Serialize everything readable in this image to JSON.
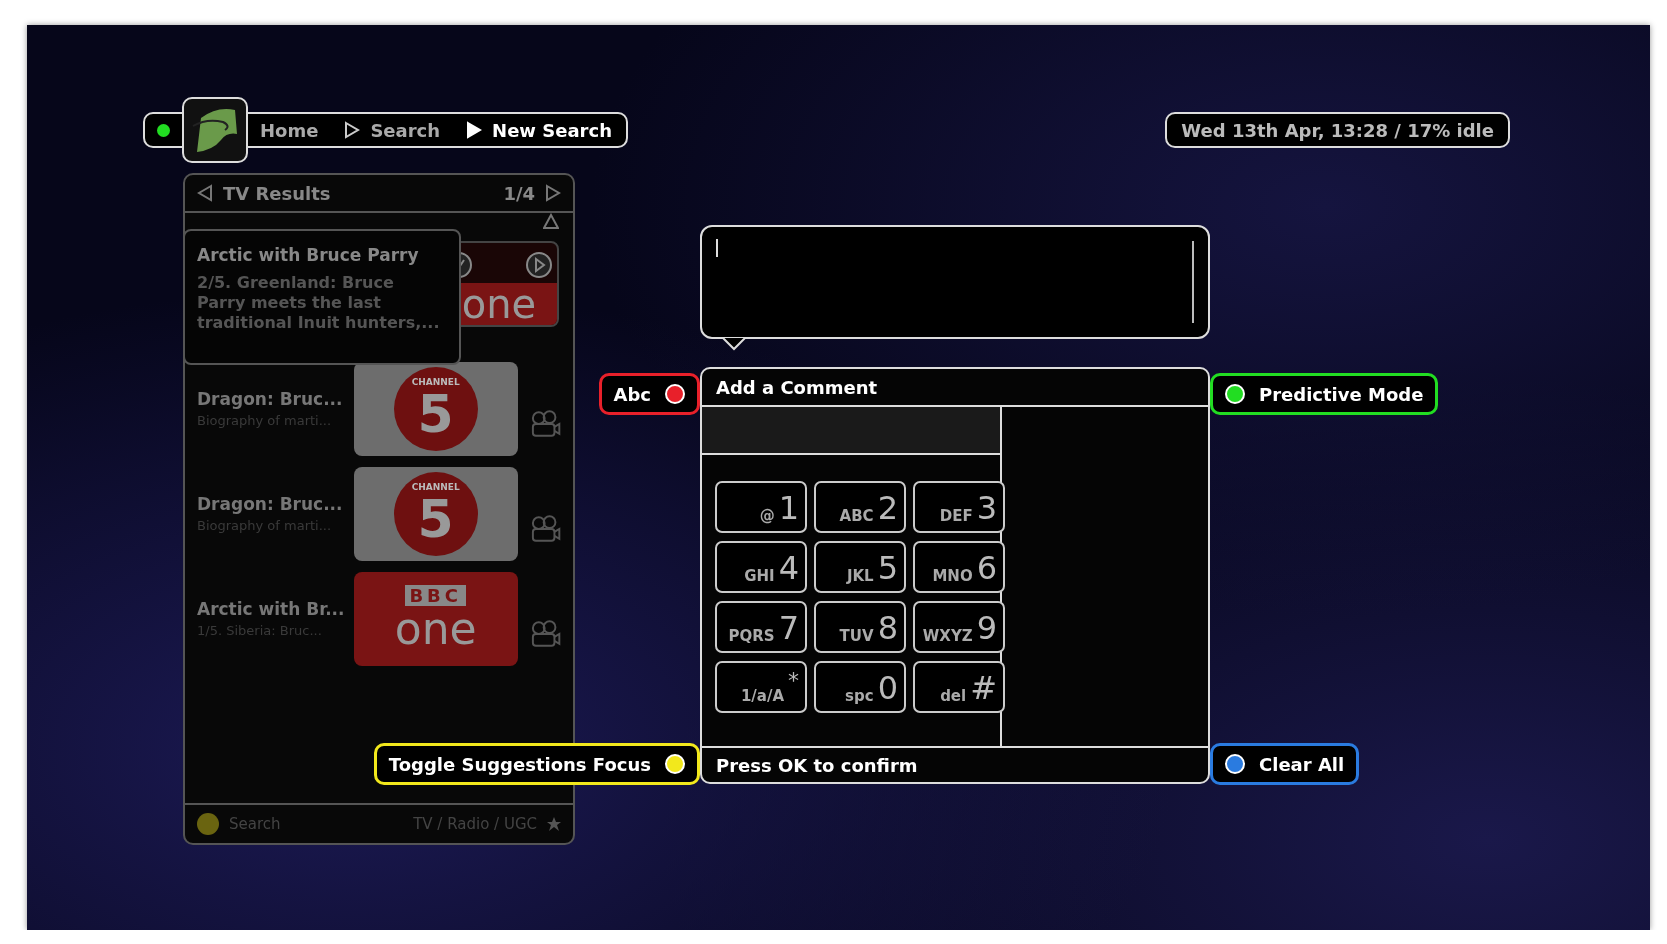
{
  "breadcrumb": {
    "items": [
      {
        "label": "Home",
        "selected": false
      },
      {
        "label": "Search",
        "selected": false
      },
      {
        "label": "New Search",
        "selected": true
      }
    ]
  },
  "status": "Wed 13th Apr, 13:28 / 17% idle",
  "results": {
    "title": "TV Results",
    "page": "1/4",
    "highlight": {
      "title": "Arctic with Bruce Parry",
      "description": "2/5. Greenland: Bruce Parry meets the last traditional Inuit hunters,...",
      "logo": {
        "kind": "bbc",
        "main": "one"
      }
    },
    "items": [
      {
        "title": "Dragon: Bruc...",
        "subtitle": "Biography of marti...",
        "logo": {
          "kind": "channel5",
          "top": "CHANNEL",
          "main": "5"
        }
      },
      {
        "title": "Dragon: Bruc...",
        "subtitle": "Biography of marti...",
        "logo": {
          "kind": "channel5",
          "top": "CHANNEL",
          "main": "5"
        }
      },
      {
        "title": "Arctic with Br...",
        "subtitle": "1/5. Siberia: Bruc...",
        "logo": {
          "kind": "bbc",
          "top": "BBC",
          "main": "one"
        }
      }
    ],
    "footer": {
      "label": "Search",
      "scope": "TV / Radio / UGC"
    }
  },
  "color_buttons": [
    {
      "label": "Abc",
      "color": "#e8202a"
    },
    {
      "label": "Predictive Mode",
      "color": "#22dd22"
    },
    {
      "label": "Toggle Suggestions Focus",
      "color": "#f2e81c"
    },
    {
      "label": "Clear All",
      "color": "#2a7be0"
    }
  ],
  "comment": {
    "title": "Add a Comment",
    "footer": "Press OK to confirm",
    "keys": [
      {
        "letters": "@",
        "digit": "1"
      },
      {
        "letters": "ABC",
        "digit": "2"
      },
      {
        "letters": "DEF",
        "digit": "3"
      },
      {
        "letters": "GHI",
        "digit": "4"
      },
      {
        "letters": "JKL",
        "digit": "5"
      },
      {
        "letters": "MNO",
        "digit": "6"
      },
      {
        "letters": "PQRS",
        "digit": "7"
      },
      {
        "letters": "TUV",
        "digit": "8"
      },
      {
        "letters": "WXYZ",
        "digit": "9"
      },
      {
        "letters": "1/a/A",
        "digit": "*",
        "raised": true
      },
      {
        "letters": "spc",
        "digit": "0"
      },
      {
        "letters": "del",
        "digit": "#"
      }
    ]
  }
}
